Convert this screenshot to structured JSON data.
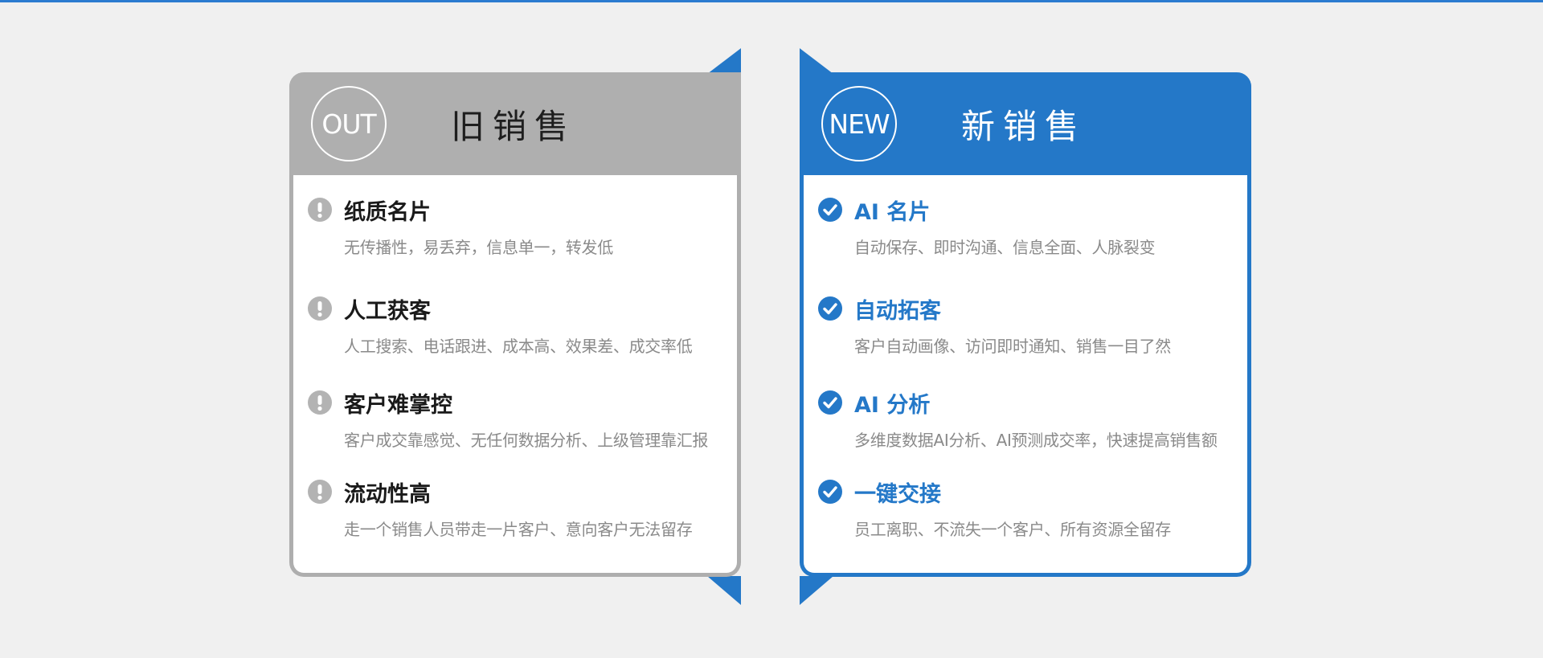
{
  "old_card": {
    "badge": "OUT",
    "title": "旧销售",
    "items": [
      {
        "title": "纸质名片",
        "desc": "无传播性，易丢弃，信息单一，转发低",
        "icon": "exclamation-icon"
      },
      {
        "title": "人工获客",
        "desc": "人工搜索、电话跟进、成本高、效果差、成交率低",
        "icon": "exclamation-icon"
      },
      {
        "title": "客户难掌控",
        "desc": "客户成交靠感觉、无任何数据分析、上级管理靠汇报",
        "icon": "exclamation-icon"
      },
      {
        "title": "流动性高",
        "desc": "走一个销售人员带走一片客户、意向客户无法留存",
        "icon": "exclamation-icon"
      }
    ]
  },
  "new_card": {
    "badge": "NEW",
    "title": "新销售",
    "items": [
      {
        "title": "AI 名片",
        "desc": "自动保存、即时沟通、信息全面、人脉裂变",
        "icon": "check-icon"
      },
      {
        "title": "自动拓客",
        "desc": "客户自动画像、访问即时通知、销售一目了然",
        "icon": "check-icon"
      },
      {
        "title": "AI 分析",
        "desc": "多维度数据AI分析、AI预测成交率，快速提高销售额",
        "icon": "check-icon"
      },
      {
        "title": "一键交接",
        "desc": "员工离职、不流失一个客户、所有资源全留存",
        "icon": "check-icon"
      }
    ]
  },
  "colors": {
    "accent": "#2478c8",
    "old_gray": "#afafaf",
    "background": "#f0f0f0"
  }
}
